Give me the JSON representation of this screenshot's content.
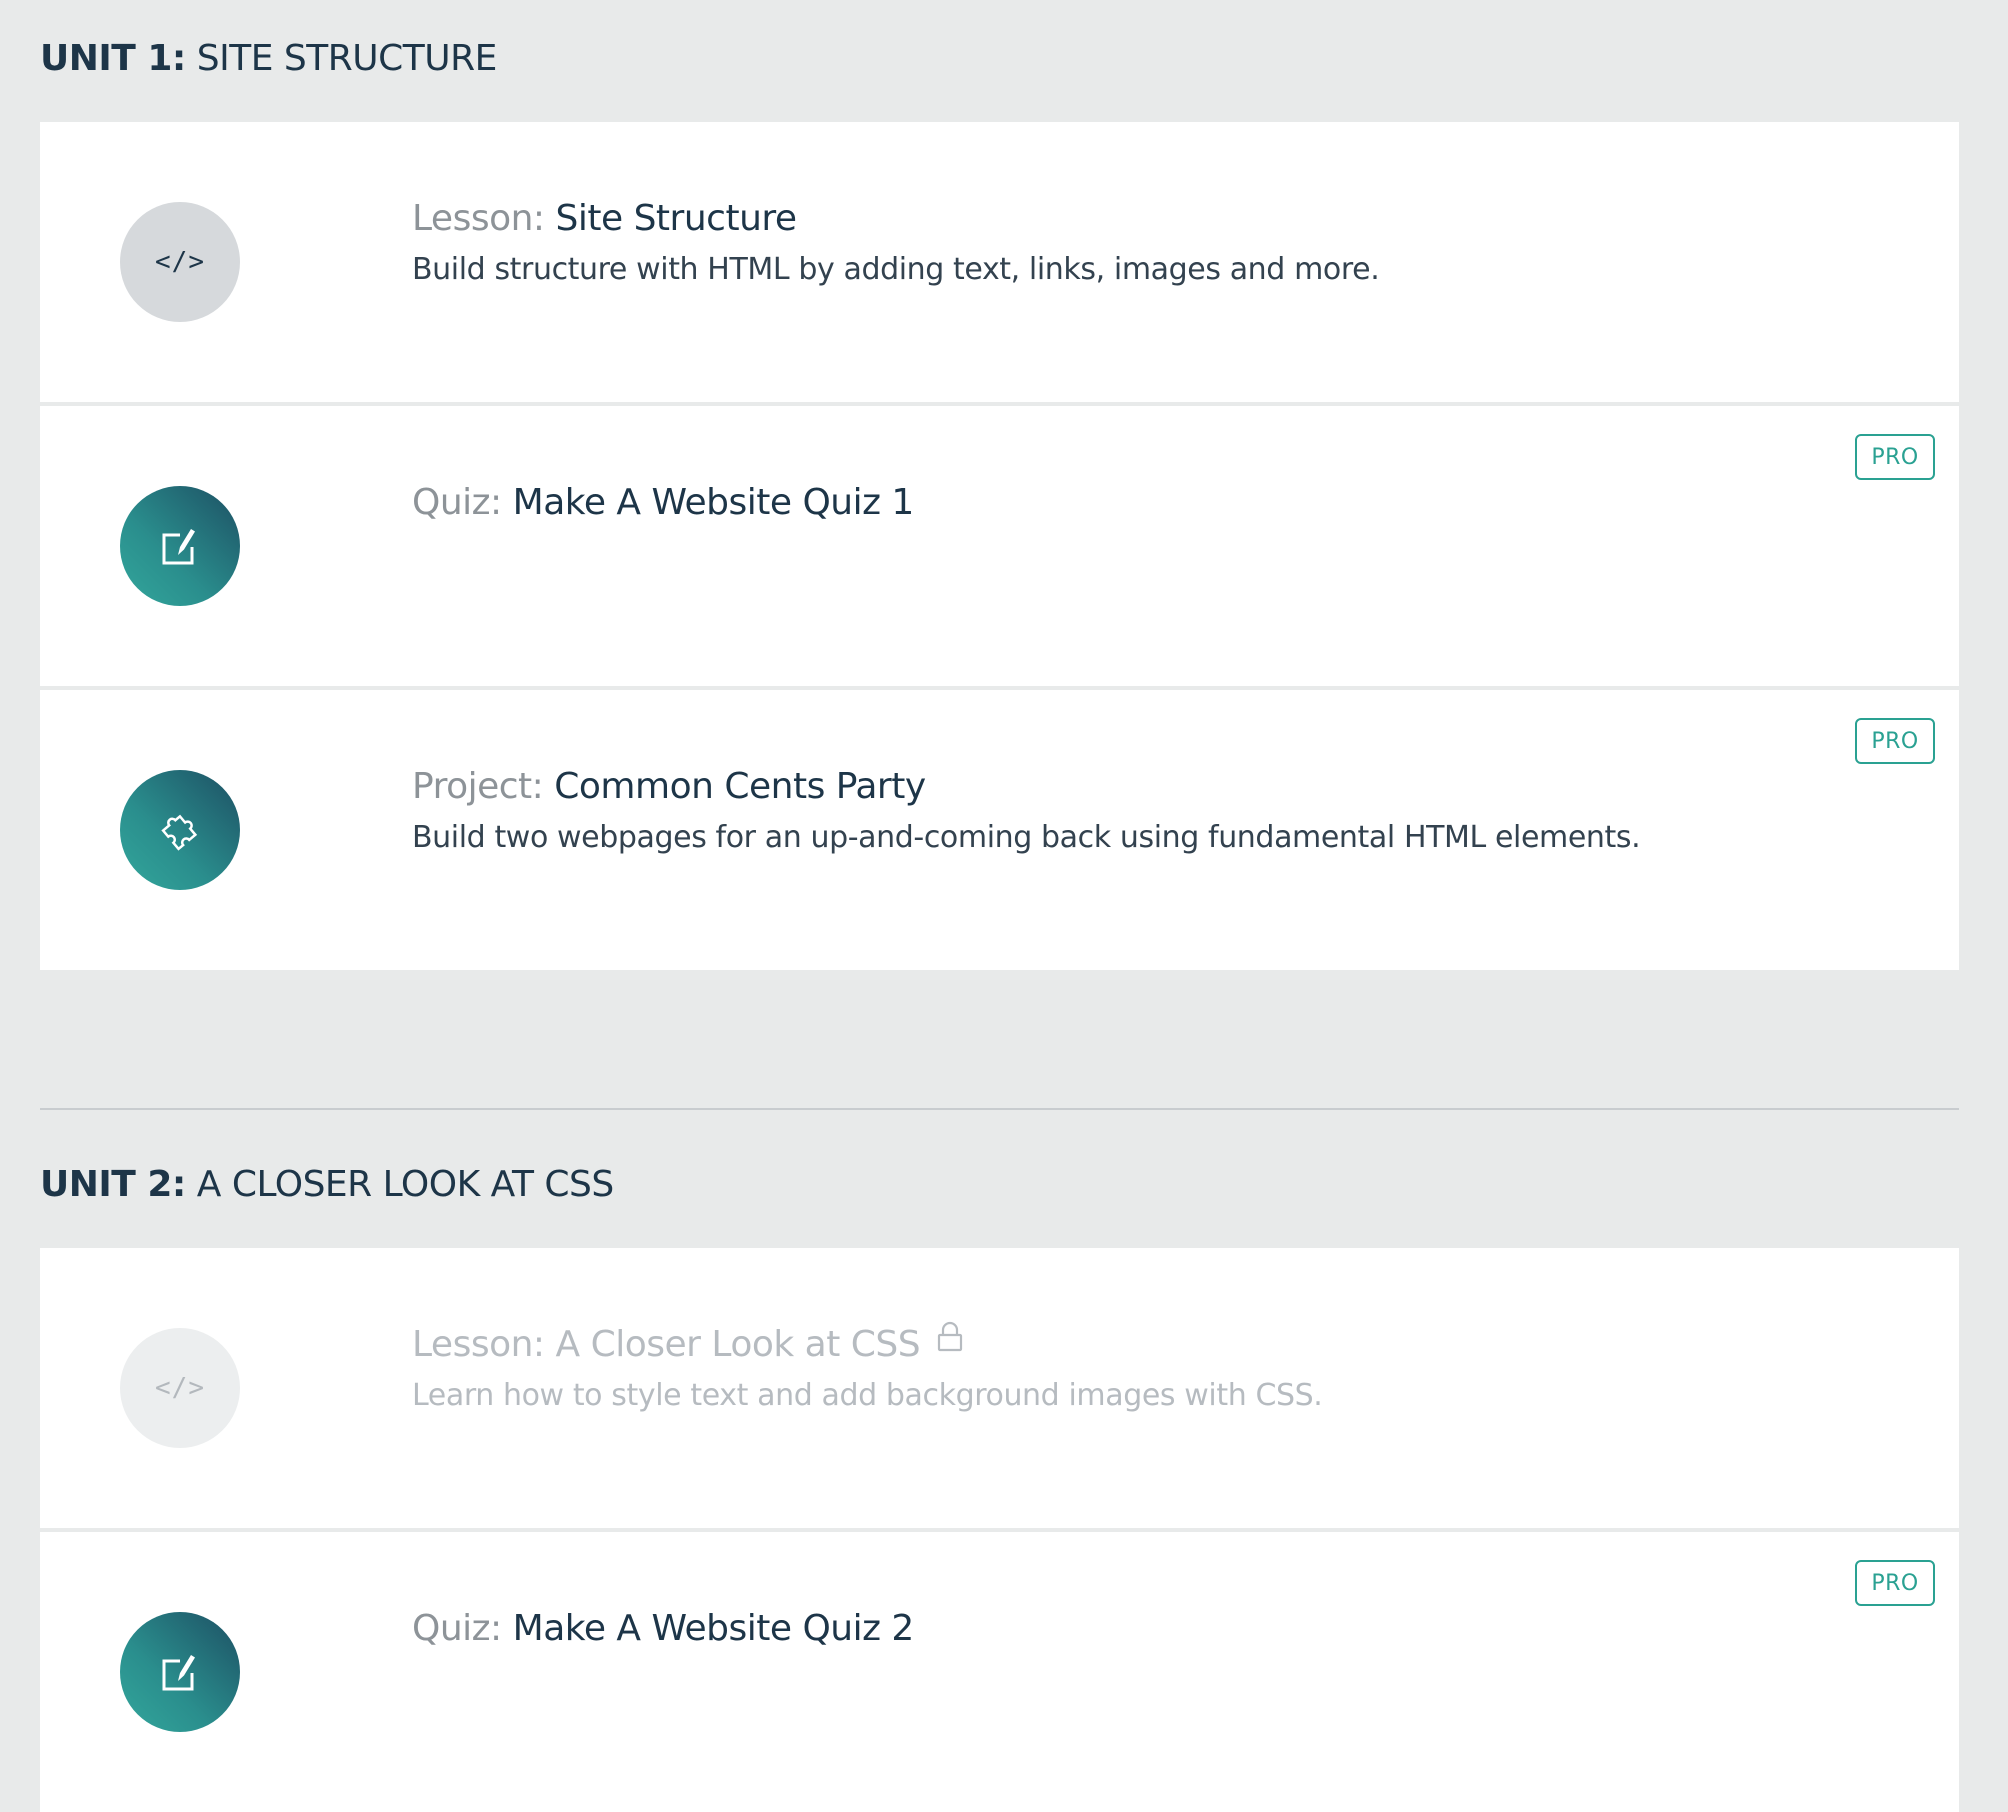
{
  "units": [
    {
      "number_label": "UNIT 1:",
      "name": "SITE STRUCTURE",
      "items": [
        {
          "kind": "Lesson:",
          "title": "Site Structure",
          "description": "Build structure with HTML by adding text, links, images and more.",
          "icon": "code-icon",
          "pro": false,
          "locked": false
        },
        {
          "kind": "Quiz:",
          "title": "Make A Website Quiz 1",
          "description": "",
          "icon": "quiz-edit-icon",
          "pro": true,
          "locked": false
        },
        {
          "kind": "Project:",
          "title": "Common Cents Party",
          "description": "Build two webpages for an up-and-coming back using fundamental HTML elements.",
          "icon": "puzzle-icon",
          "pro": true,
          "locked": false
        }
      ]
    },
    {
      "number_label": "UNIT 2:",
      "name": "A CLOSER LOOK AT CSS",
      "items": [
        {
          "kind": "Lesson:",
          "title": "A Closer Look at CSS",
          "description": "Learn how to style text and add background images with CSS.",
          "icon": "code-icon",
          "pro": false,
          "locked": true
        },
        {
          "kind": "Quiz:",
          "title": "Make A Website Quiz 2",
          "description": "",
          "icon": "quiz-edit-icon",
          "pro": true,
          "locked": false
        }
      ]
    }
  ],
  "code_glyph": "</>",
  "pro_label": "PRO",
  "colors": {
    "background": "#e8eaea",
    "card": "#ffffff",
    "text_dark": "#1d3548",
    "text_kind": "#8d9398",
    "teal_accent": "#2aa192",
    "locked_text": "#b6bbc0"
  }
}
